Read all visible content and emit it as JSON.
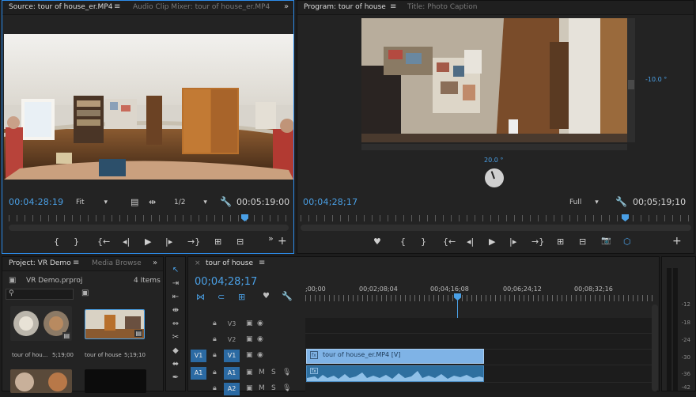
{
  "source_panel": {
    "tabs": [
      "Source: tour of house_er.MP4",
      "Audio Clip Mixer: tour of house_er.MP4"
    ],
    "menu_glyph": "≡",
    "overflow_glyph": "»",
    "timecode_in": "00:04:28:19",
    "fit_label": "Fit",
    "resolution": "1/2",
    "timecode_dur": "00:05:19:00",
    "controls": [
      "{",
      "}",
      "{←",
      "◂|",
      "▶",
      "|▸",
      "→}",
      "⊞",
      "⊟",
      "»",
      "+"
    ]
  },
  "program_panel": {
    "tabs": [
      "Program: tour of house",
      "Title: Photo Caption"
    ],
    "timecode_in": "00;04;28;17",
    "full_label": "Full",
    "timecode_dur": "00;05;19;10",
    "angle_right": "-10.0 °",
    "angle_bottom": "20.0 °",
    "controls": [
      "♥",
      "{",
      "}",
      "{←",
      "◂|",
      "▶",
      "|▸",
      "→}",
      "⊞",
      "⊟",
      "📷",
      "⬡",
      "+"
    ]
  },
  "project_panel": {
    "tabs": [
      "Project: VR Demo",
      "Media Browse"
    ],
    "file_name": "VR Demo.prproj",
    "item_count": "4 Items",
    "search_placeholder": "",
    "items": [
      {
        "name": "tour of hou...",
        "duration": "5;19;00"
      },
      {
        "name": "tour of house",
        "duration": "5;19;10"
      }
    ]
  },
  "timeline_panel": {
    "tab": "tour of house",
    "timecode": "00;04;28;17",
    "ruler_labels": [
      ";00;00",
      "00;02;08;04",
      "00;04;16;08",
      "00;06;24;12",
      "00;08;32;16"
    ],
    "tracks": [
      {
        "src": "",
        "name": "V3"
      },
      {
        "src": "",
        "name": "V2"
      },
      {
        "src": "V1",
        "name": "V1"
      },
      {
        "src": "A1",
        "name": "A1"
      },
      {
        "src": "",
        "name": "A2"
      }
    ],
    "clip_label": "tour of house_er.MP4 [V]",
    "fx_glyph": "fx"
  },
  "audio_meter": {
    "labels": [
      "-12",
      "-18",
      "-24",
      "-30",
      "-36",
      "-42"
    ]
  },
  "colors": {
    "accent": "#2d8ceb",
    "timecode": "#4aa0e6",
    "clip": "#7fb3e6",
    "audio_clip": "#2e6f9f"
  }
}
